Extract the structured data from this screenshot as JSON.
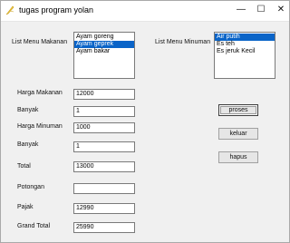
{
  "window": {
    "title": "tugas program yolan"
  },
  "controls": {
    "minimize": "—",
    "maximize": "☐",
    "close": "✕"
  },
  "labels": {
    "menu_makanan": "List Menu Makanan",
    "menu_minuman": "List Menu Minuman",
    "harga_makanan": "Harga Makanan",
    "banyak1": "Banyak",
    "harga_minuman": "Harga Minuman",
    "banyak2": "Banyak",
    "total": "Total",
    "potongan": "Potongan",
    "pajak": "Pajak",
    "grand_total": "Grand Total"
  },
  "food_list": [
    {
      "label": "Ayam goreng",
      "selected": false
    },
    {
      "label": "Ayam geprek",
      "selected": true
    },
    {
      "label": "Ayam bakar",
      "selected": false
    }
  ],
  "drink_list": [
    {
      "label": "Air putih",
      "selected": true
    },
    {
      "label": "Es teh",
      "selected": false
    },
    {
      "label": "Es jeruk Kecil",
      "selected": false
    }
  ],
  "fields": {
    "harga_makanan": "12000",
    "banyak1": "1",
    "harga_minuman": "1000",
    "banyak2": "1",
    "total": "13000",
    "potongan": "",
    "pajak": "12990",
    "grand_total": "25990"
  },
  "buttons": {
    "proses": "proses",
    "keluar": "keluar",
    "hapus": "hapus"
  },
  "colors": {
    "selection": "#0a64c8"
  }
}
